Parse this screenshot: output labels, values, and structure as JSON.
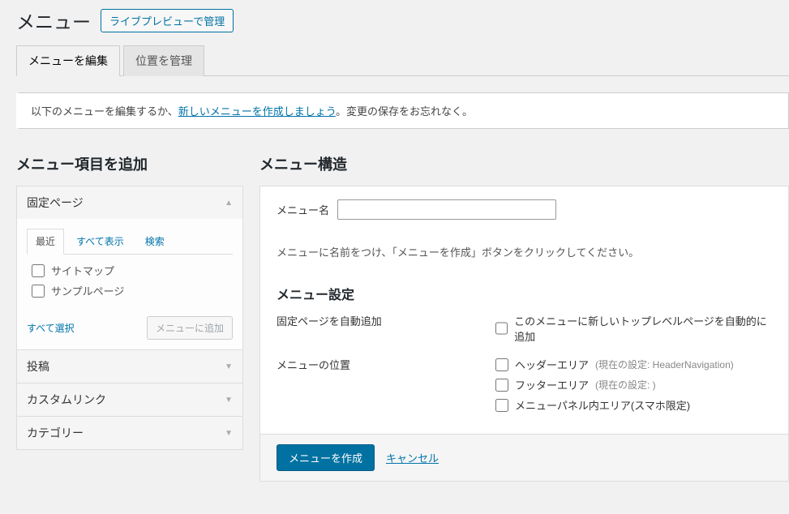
{
  "header": {
    "title": "メニュー",
    "live_preview_btn": "ライブプレビューで管理"
  },
  "tabs": {
    "edit": "メニューを編集",
    "locations": "位置を管理"
  },
  "notice": {
    "before": "以下のメニューを編集するか、",
    "link": "新しいメニューを作成しましょう",
    "after": "。変更の保存をお忘れなく。"
  },
  "left": {
    "heading": "メニュー項目を追加",
    "acc": {
      "pages": "固定ページ",
      "posts": "投稿",
      "custom": "カスタムリンク",
      "categories": "カテゴリー"
    },
    "subtabs": {
      "recent": "最近",
      "all": "すべて表示",
      "search": "検索"
    },
    "items": {
      "sitemap": "サイトマップ",
      "sample": "サンプルページ"
    },
    "select_all": "すべて選択",
    "add_to_menu": "メニューに追加"
  },
  "right": {
    "heading": "メニュー構造",
    "menu_name_label": "メニュー名",
    "hint": "メニューに名前をつけ、「メニューを作成」ボタンをクリックしてください。",
    "settings_head": "メニュー設定",
    "auto_add_label": "固定ページを自動追加",
    "auto_add_opt": "このメニューに新しいトップレベルページを自動的に追加",
    "location_label": "メニューの位置",
    "loc_header": "ヘッダーエリア",
    "loc_header_sub": "(現在の設定: HeaderNavigation)",
    "loc_footer": "フッターエリア",
    "loc_footer_sub": "(現在の設定: )",
    "loc_panel": "メニューパネル内エリア(スマホ限定)",
    "create_btn": "メニューを作成",
    "cancel": "キャンセル"
  }
}
